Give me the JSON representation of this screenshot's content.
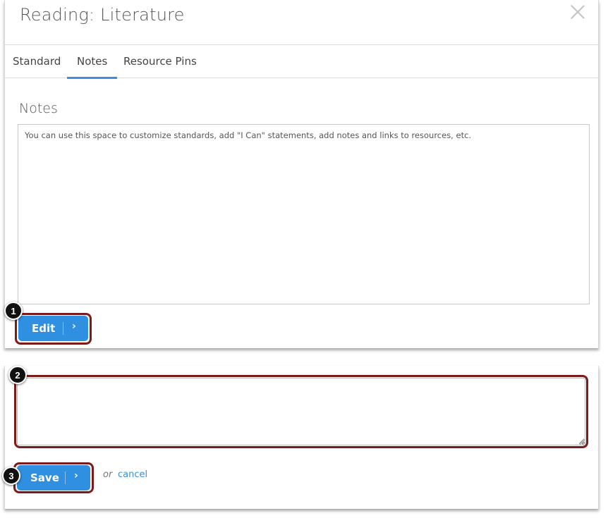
{
  "dialog": {
    "title": "Reading: Literature",
    "close_icon": "close-icon"
  },
  "tabs": [
    {
      "label": "Standard",
      "active": false
    },
    {
      "label": "Notes",
      "active": true
    },
    {
      "label": "Resource Pins",
      "active": false
    }
  ],
  "notes": {
    "heading": "Notes",
    "content": "You can use this space to customize standards, add \"I Can\" statements, add notes and links to resources, etc."
  },
  "edit_button": {
    "label": "Edit",
    "chevron": "›",
    "icon": "chevron-right-icon"
  },
  "editor": {
    "value": "",
    "placeholder": ""
  },
  "save_button": {
    "label": "Save",
    "chevron": "›",
    "icon": "chevron-right-icon"
  },
  "or_text": "or",
  "cancel_link": "cancel",
  "callouts": [
    "1",
    "2",
    "3"
  ],
  "colors": {
    "accent": "#2f8fe0",
    "tab_underline": "#3d8fdc",
    "highlight": "#7d1b1b",
    "badge": "#111111",
    "link": "#3a8ed6"
  }
}
